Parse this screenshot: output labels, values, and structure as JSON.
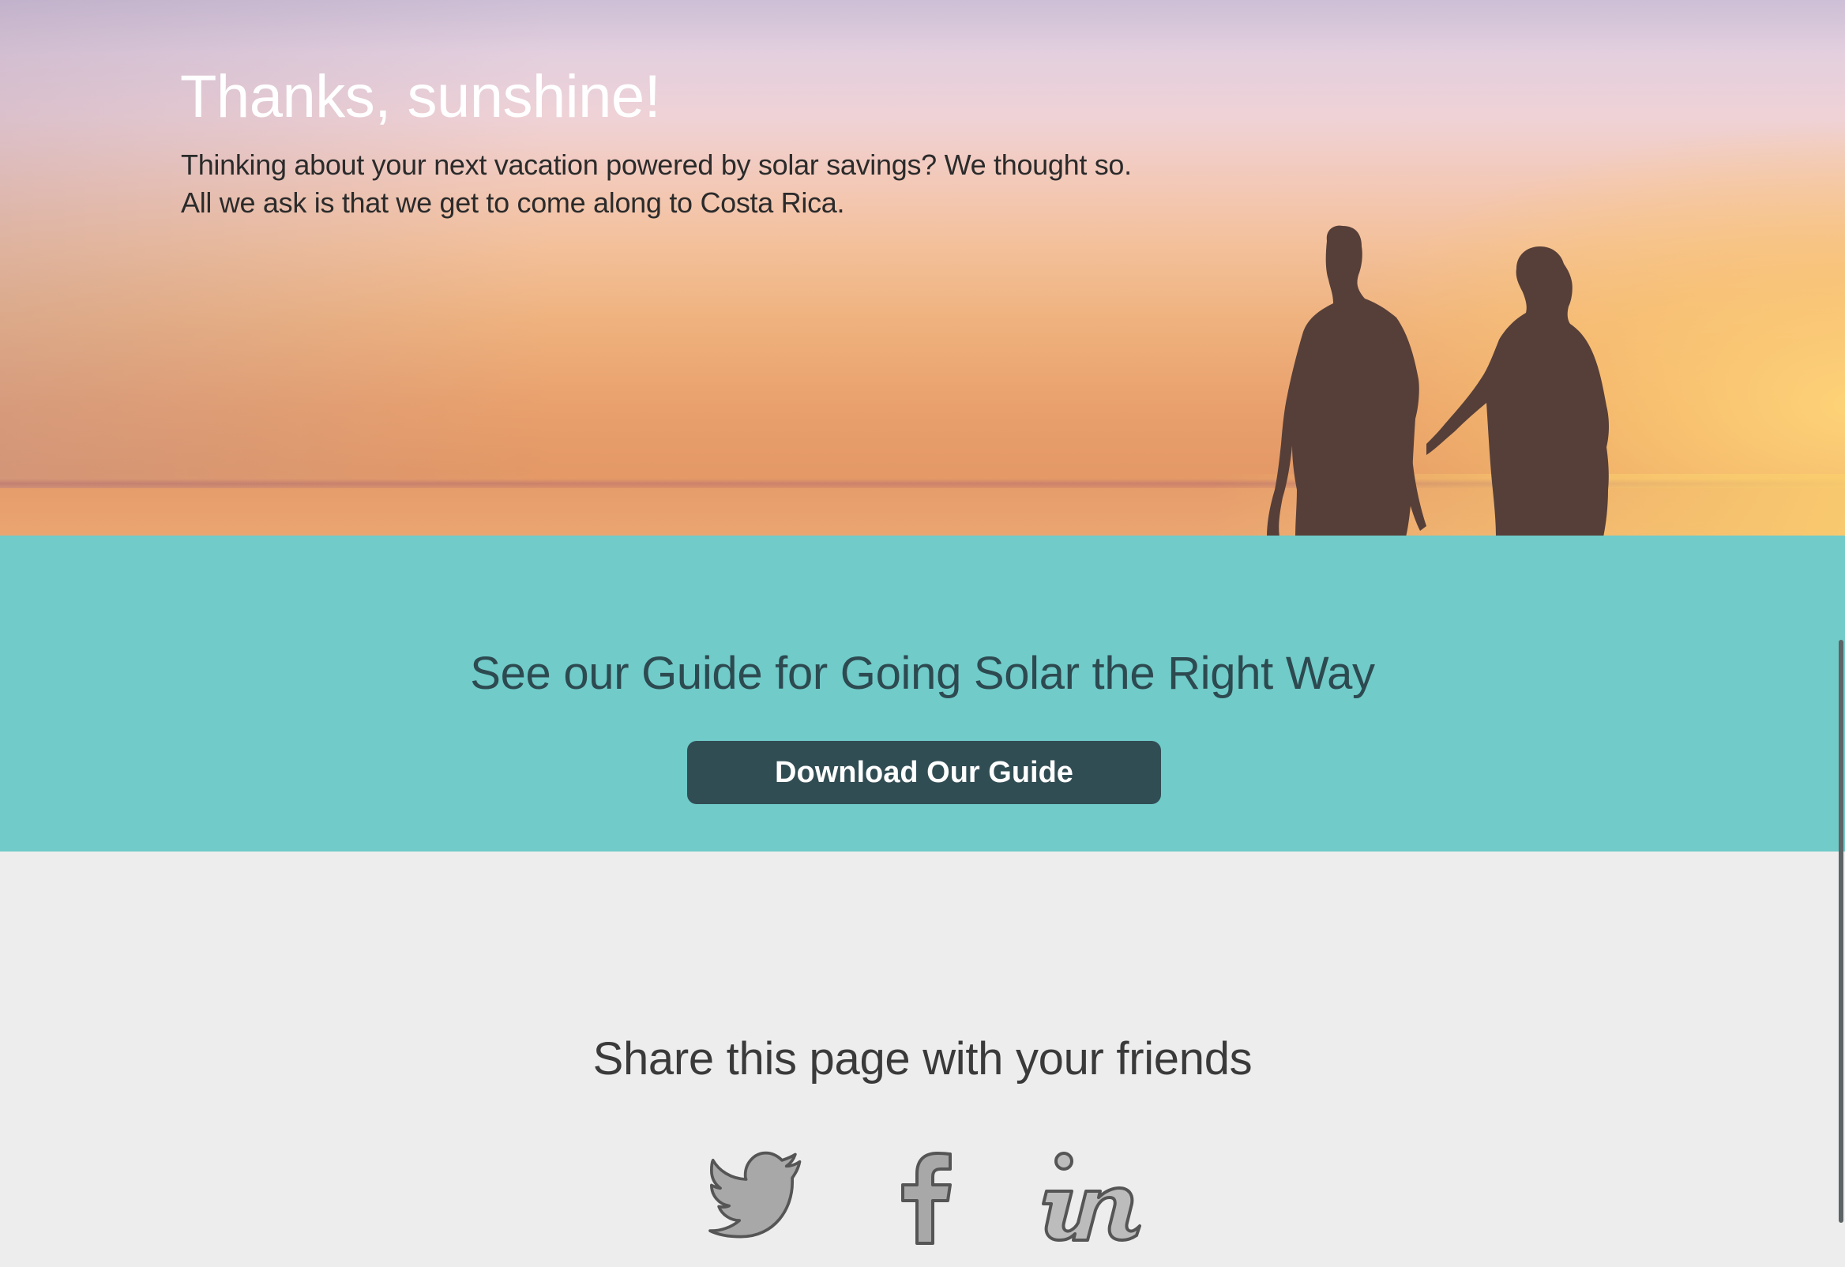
{
  "hero": {
    "title": "Thanks, sunshine!",
    "text": "Thinking about your next vacation powered by solar savings? We thought so. All we ask is that we get to come along to Costa Rica."
  },
  "guide": {
    "heading": "See our Guide for Going Solar the Right Way",
    "button_label": "Download Our Guide"
  },
  "share": {
    "heading": "Share this page with your friends",
    "icons": [
      "twitter-icon",
      "facebook-icon",
      "invision-icon"
    ]
  },
  "colors": {
    "teal_band": "#70cbc9",
    "button": "#314d54",
    "share_bg": "#ededed",
    "icon_stroke": "#555555"
  }
}
